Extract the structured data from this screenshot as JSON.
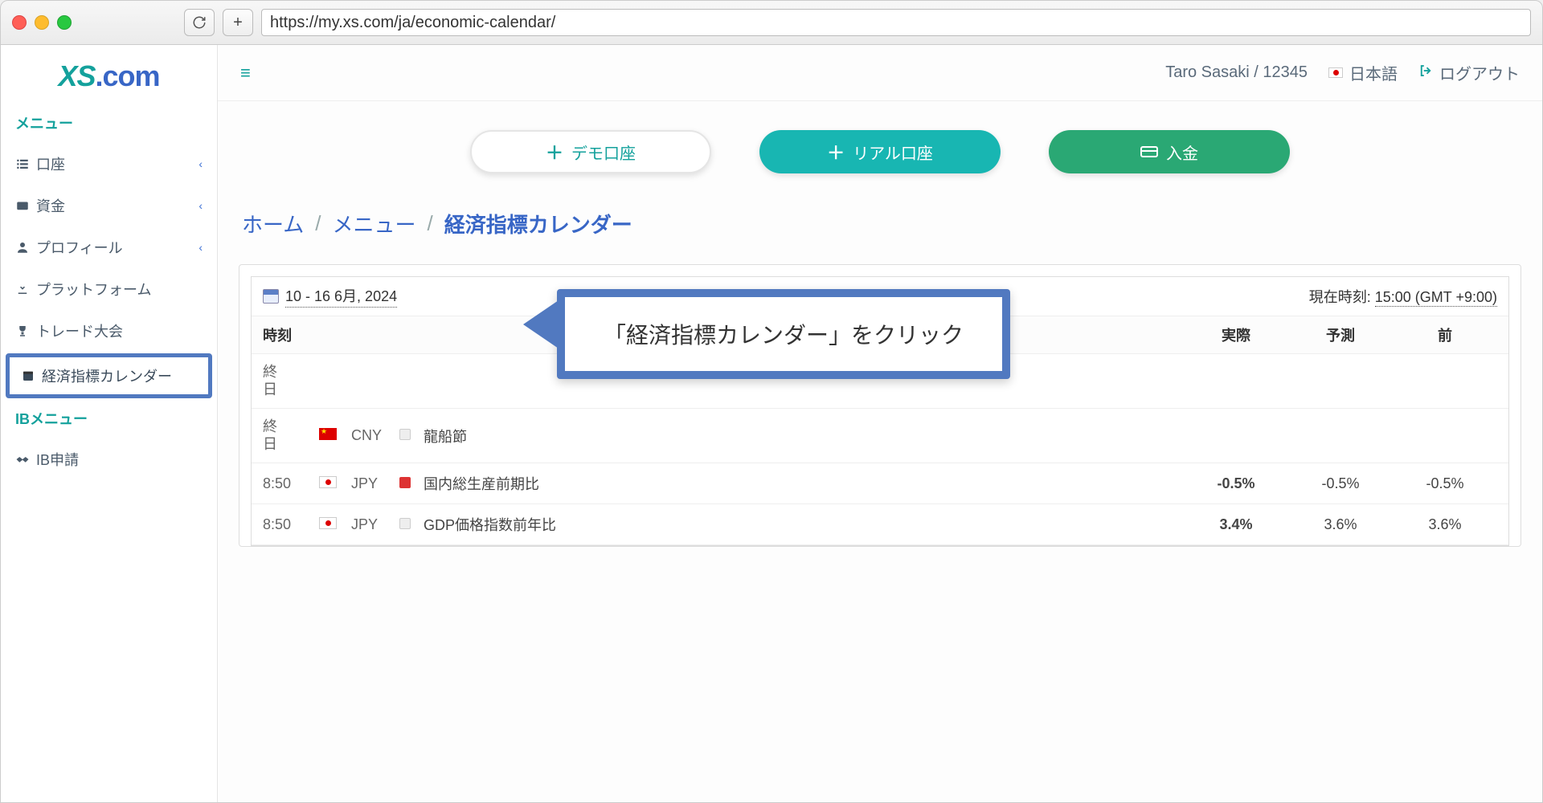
{
  "browser": {
    "url": "https://my.xs.com/ja/economic-calendar/"
  },
  "logo": {
    "xs": "XS",
    "dot": ".",
    "com": "com"
  },
  "sidebar": {
    "menu_label": "メニュー",
    "ib_label": "IBメニュー",
    "items": {
      "account": {
        "label": "口座"
      },
      "funds": {
        "label": "資金"
      },
      "profile": {
        "label": "プロフィール"
      },
      "platform": {
        "label": "プラットフォーム"
      },
      "contest": {
        "label": "トレード大会"
      },
      "calendar": {
        "label": "経済指標カレンダー"
      },
      "ib_apply": {
        "label": "IB申請"
      }
    }
  },
  "topbar": {
    "user": "Taro Sasaki / 12345",
    "language": "日本語",
    "logout": "ログアウト"
  },
  "actions": {
    "demo": "デモ口座",
    "real": "リアル口座",
    "deposit": "入金"
  },
  "breadcrumb": {
    "home": "ホーム",
    "menu": "メニュー",
    "current": "経済指標カレンダー"
  },
  "calendar": {
    "date_range": "10 - 16 6月, 2024",
    "now_label": "現在時刻:",
    "now_time": "15:00 (GMT +9:00)",
    "headers": {
      "time": "時刻",
      "actual": "実際",
      "forecast": "予測",
      "previous": "前"
    },
    "rows": [
      {
        "time": "終日",
        "flag": "",
        "cur": "",
        "imp": "",
        "event": "",
        "actual": "",
        "forecast": "",
        "previous": ""
      },
      {
        "time": "終日",
        "flag": "cn",
        "cur": "CNY",
        "imp": "low",
        "event": "龍船節",
        "actual": "",
        "forecast": "",
        "previous": ""
      },
      {
        "time": "8:50",
        "flag": "jp",
        "cur": "JPY",
        "imp": "high",
        "event": "国内総生産前期比",
        "actual": "-0.5%",
        "actual_class": "neg",
        "forecast": "-0.5%",
        "previous": "-0.5%"
      },
      {
        "time": "8:50",
        "flag": "jp",
        "cur": "JPY",
        "imp": "low",
        "event": "GDP価格指数前年比",
        "actual": "3.4%",
        "actual_class": "pos",
        "forecast": "3.6%",
        "previous": "3.6%"
      }
    ]
  },
  "callout": {
    "text": "「経済指標カレンダー」をクリック"
  }
}
